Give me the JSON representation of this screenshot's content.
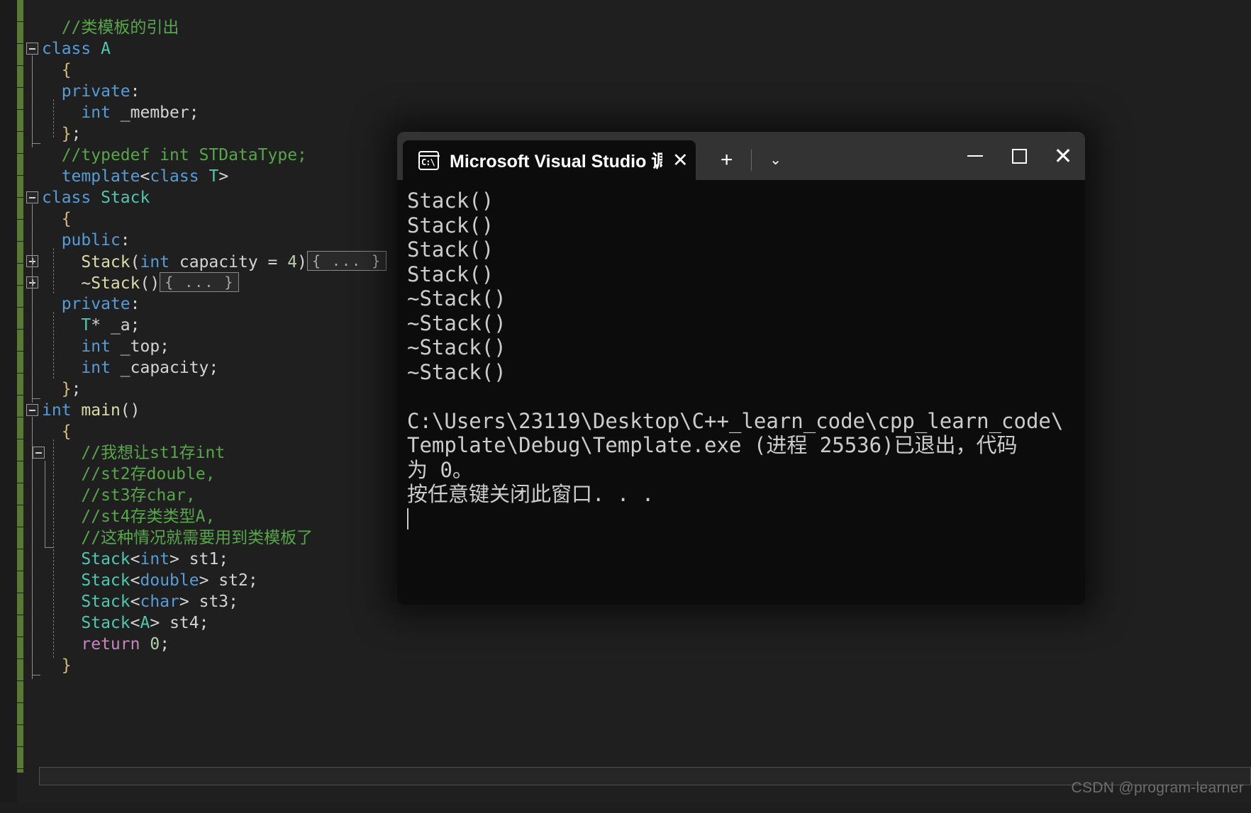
{
  "editor": {
    "name": "visual-studio-code-editor",
    "language": "C++",
    "code_lines": [
      {
        "indent": 2,
        "fold": null,
        "tokens": [
          {
            "t": "//类模板的引出",
            "c": "cmt"
          }
        ]
      },
      {
        "indent": 0,
        "fold": "minus",
        "tokens": [
          {
            "t": "class ",
            "c": "kw"
          },
          {
            "t": "A",
            "c": "type"
          }
        ]
      },
      {
        "indent": 2,
        "fold": null,
        "tokens": [
          {
            "t": "{",
            "c": "brace"
          }
        ]
      },
      {
        "indent": 2,
        "fold": null,
        "tokens": [
          {
            "t": "private",
            "c": "kw"
          },
          {
            "t": ":",
            "c": "punc"
          }
        ]
      },
      {
        "indent": 4,
        "fold": null,
        "tokens": [
          {
            "t": "int",
            "c": "kw"
          },
          {
            "t": " _member;",
            "c": "plain"
          }
        ]
      },
      {
        "indent": 2,
        "fold": null,
        "tokens": [
          {
            "t": "}",
            "c": "brace"
          },
          {
            "t": ";",
            "c": "punc"
          }
        ]
      },
      {
        "indent": 2,
        "fold": null,
        "tokens": [
          {
            "t": "//typedef int STDataType;",
            "c": "cmt"
          }
        ]
      },
      {
        "indent": 2,
        "fold": null,
        "tokens": [
          {
            "t": "template",
            "c": "kw"
          },
          {
            "t": "<",
            "c": "punc"
          },
          {
            "t": "class",
            "c": "kw"
          },
          {
            "t": " ",
            "c": "plain"
          },
          {
            "t": "T",
            "c": "type"
          },
          {
            "t": ">",
            "c": "punc"
          }
        ]
      },
      {
        "indent": 0,
        "fold": "minus",
        "tokens": [
          {
            "t": "class ",
            "c": "kw"
          },
          {
            "t": "Stack",
            "c": "type"
          }
        ]
      },
      {
        "indent": 2,
        "fold": null,
        "tokens": [
          {
            "t": "{",
            "c": "brace"
          }
        ]
      },
      {
        "indent": 2,
        "fold": null,
        "tokens": [
          {
            "t": "public",
            "c": "kw"
          },
          {
            "t": ":",
            "c": "punc"
          }
        ]
      },
      {
        "indent": 4,
        "fold": "plus",
        "tokens": [
          {
            "t": "Stack",
            "c": "fn"
          },
          {
            "t": "(",
            "c": "punc"
          },
          {
            "t": "int",
            "c": "kw"
          },
          {
            "t": " capacity",
            "c": "plain"
          },
          {
            "t": " = ",
            "c": "punc"
          },
          {
            "t": "4",
            "c": "num"
          },
          {
            "t": ")",
            "c": "punc"
          },
          {
            "t": "{ ... }",
            "c": "chip"
          }
        ]
      },
      {
        "indent": 4,
        "fold": "plus",
        "tokens": [
          {
            "t": "~Stack",
            "c": "fn"
          },
          {
            "t": "()",
            "c": "punc"
          },
          {
            "t": "{ ... }",
            "c": "chip"
          }
        ]
      },
      {
        "indent": 2,
        "fold": null,
        "tokens": [
          {
            "t": "private",
            "c": "kw"
          },
          {
            "t": ":",
            "c": "punc"
          }
        ]
      },
      {
        "indent": 4,
        "fold": null,
        "tokens": [
          {
            "t": "T",
            "c": "type"
          },
          {
            "t": "* _a;",
            "c": "plain"
          }
        ]
      },
      {
        "indent": 4,
        "fold": null,
        "tokens": [
          {
            "t": "int",
            "c": "kw"
          },
          {
            "t": " _top;",
            "c": "plain"
          }
        ]
      },
      {
        "indent": 4,
        "fold": null,
        "tokens": [
          {
            "t": "int",
            "c": "kw"
          },
          {
            "t": " _capacity;",
            "c": "plain"
          }
        ]
      },
      {
        "indent": 2,
        "fold": null,
        "tokens": [
          {
            "t": "}",
            "c": "brace"
          },
          {
            "t": ";",
            "c": "punc"
          }
        ]
      },
      {
        "indent": 0,
        "fold": "minus",
        "tokens": [
          {
            "t": "int",
            "c": "kw"
          },
          {
            "t": " ",
            "c": "plain"
          },
          {
            "t": "main",
            "c": "fn"
          },
          {
            "t": "()",
            "c": "punc"
          }
        ]
      },
      {
        "indent": 2,
        "fold": null,
        "tokens": [
          {
            "t": "{",
            "c": "brace"
          }
        ]
      },
      {
        "indent": 4,
        "fold": "minus2",
        "tokens": [
          {
            "t": "//我想让st1存int",
            "c": "cmt"
          }
        ]
      },
      {
        "indent": 4,
        "fold": null,
        "tokens": [
          {
            "t": "//st2存double,",
            "c": "cmt"
          }
        ]
      },
      {
        "indent": 4,
        "fold": null,
        "tokens": [
          {
            "t": "//st3存char,",
            "c": "cmt"
          }
        ]
      },
      {
        "indent": 4,
        "fold": null,
        "tokens": [
          {
            "t": "//st4存类类型A,",
            "c": "cmt"
          }
        ]
      },
      {
        "indent": 4,
        "fold": null,
        "tokens": [
          {
            "t": "//这种情况就需要用到类模板了",
            "c": "cmt"
          }
        ]
      },
      {
        "indent": 4,
        "fold": null,
        "tokens": [
          {
            "t": "Stack",
            "c": "type"
          },
          {
            "t": "<",
            "c": "punc"
          },
          {
            "t": "int",
            "c": "kw"
          },
          {
            "t": ">",
            "c": "punc"
          },
          {
            "t": " st1;",
            "c": "plain"
          }
        ]
      },
      {
        "indent": 4,
        "fold": null,
        "tokens": [
          {
            "t": "Stack",
            "c": "type"
          },
          {
            "t": "<",
            "c": "punc"
          },
          {
            "t": "double",
            "c": "kw"
          },
          {
            "t": ">",
            "c": "punc"
          },
          {
            "t": " st2;",
            "c": "plain"
          }
        ]
      },
      {
        "indent": 4,
        "fold": null,
        "tokens": [
          {
            "t": "Stack",
            "c": "type"
          },
          {
            "t": "<",
            "c": "punc"
          },
          {
            "t": "char",
            "c": "kw"
          },
          {
            "t": ">",
            "c": "punc"
          },
          {
            "t": " st3;",
            "c": "plain"
          }
        ]
      },
      {
        "indent": 4,
        "fold": null,
        "tokens": [
          {
            "t": "Stack",
            "c": "type"
          },
          {
            "t": "<",
            "c": "punc"
          },
          {
            "t": "A",
            "c": "type"
          },
          {
            "t": ">",
            "c": "punc"
          },
          {
            "t": " st4;",
            "c": "plain"
          }
        ]
      },
      {
        "indent": 4,
        "fold": null,
        "tokens": [
          {
            "t": "return",
            "c": "ctl"
          },
          {
            "t": " ",
            "c": "plain"
          },
          {
            "t": "0",
            "c": "num"
          },
          {
            "t": ";",
            "c": "punc"
          }
        ]
      },
      {
        "indent": 2,
        "fold": null,
        "tokens": [
          {
            "t": "}",
            "c": "brace"
          }
        ]
      }
    ]
  },
  "terminal": {
    "window_title": "Microsoft Visual Studio 调试控制台",
    "tab_title": "Microsoft Visual Studio 调试控",
    "tab_close_label": "✕",
    "new_tab_label": "+",
    "dropdown_label": "⌄",
    "minimize_label": "—",
    "maximize_label": "□",
    "close_label": "✕",
    "icon_label": "C:\\",
    "output_lines": [
      "Stack()",
      "Stack()",
      "Stack()",
      "Stack()",
      "~Stack()",
      "~Stack()",
      "~Stack()",
      "~Stack()",
      "",
      "C:\\Users\\23119\\Desktop\\C++_learn_code\\cpp_learn_code\\",
      "Template\\Debug\\Template.exe (进程 25536)已退出，代码",
      "为 0。",
      "按任意键关闭此窗口. . ."
    ]
  },
  "watermark": {
    "text": "CSDN @program-learner"
  },
  "colors": {
    "editor_bg": "#1f1f1f",
    "terminal_bg": "#0c0c0c",
    "titlebar_bg": "#333333",
    "change_bar": "#5a7a34",
    "keyword": "#569cd6",
    "type": "#4ec9b0",
    "comment": "#57a64a",
    "function": "#dcdcaa",
    "number": "#b5cea8",
    "control": "#c586c0",
    "brace": "#d7ba7d",
    "text": "#d4d4d4"
  }
}
